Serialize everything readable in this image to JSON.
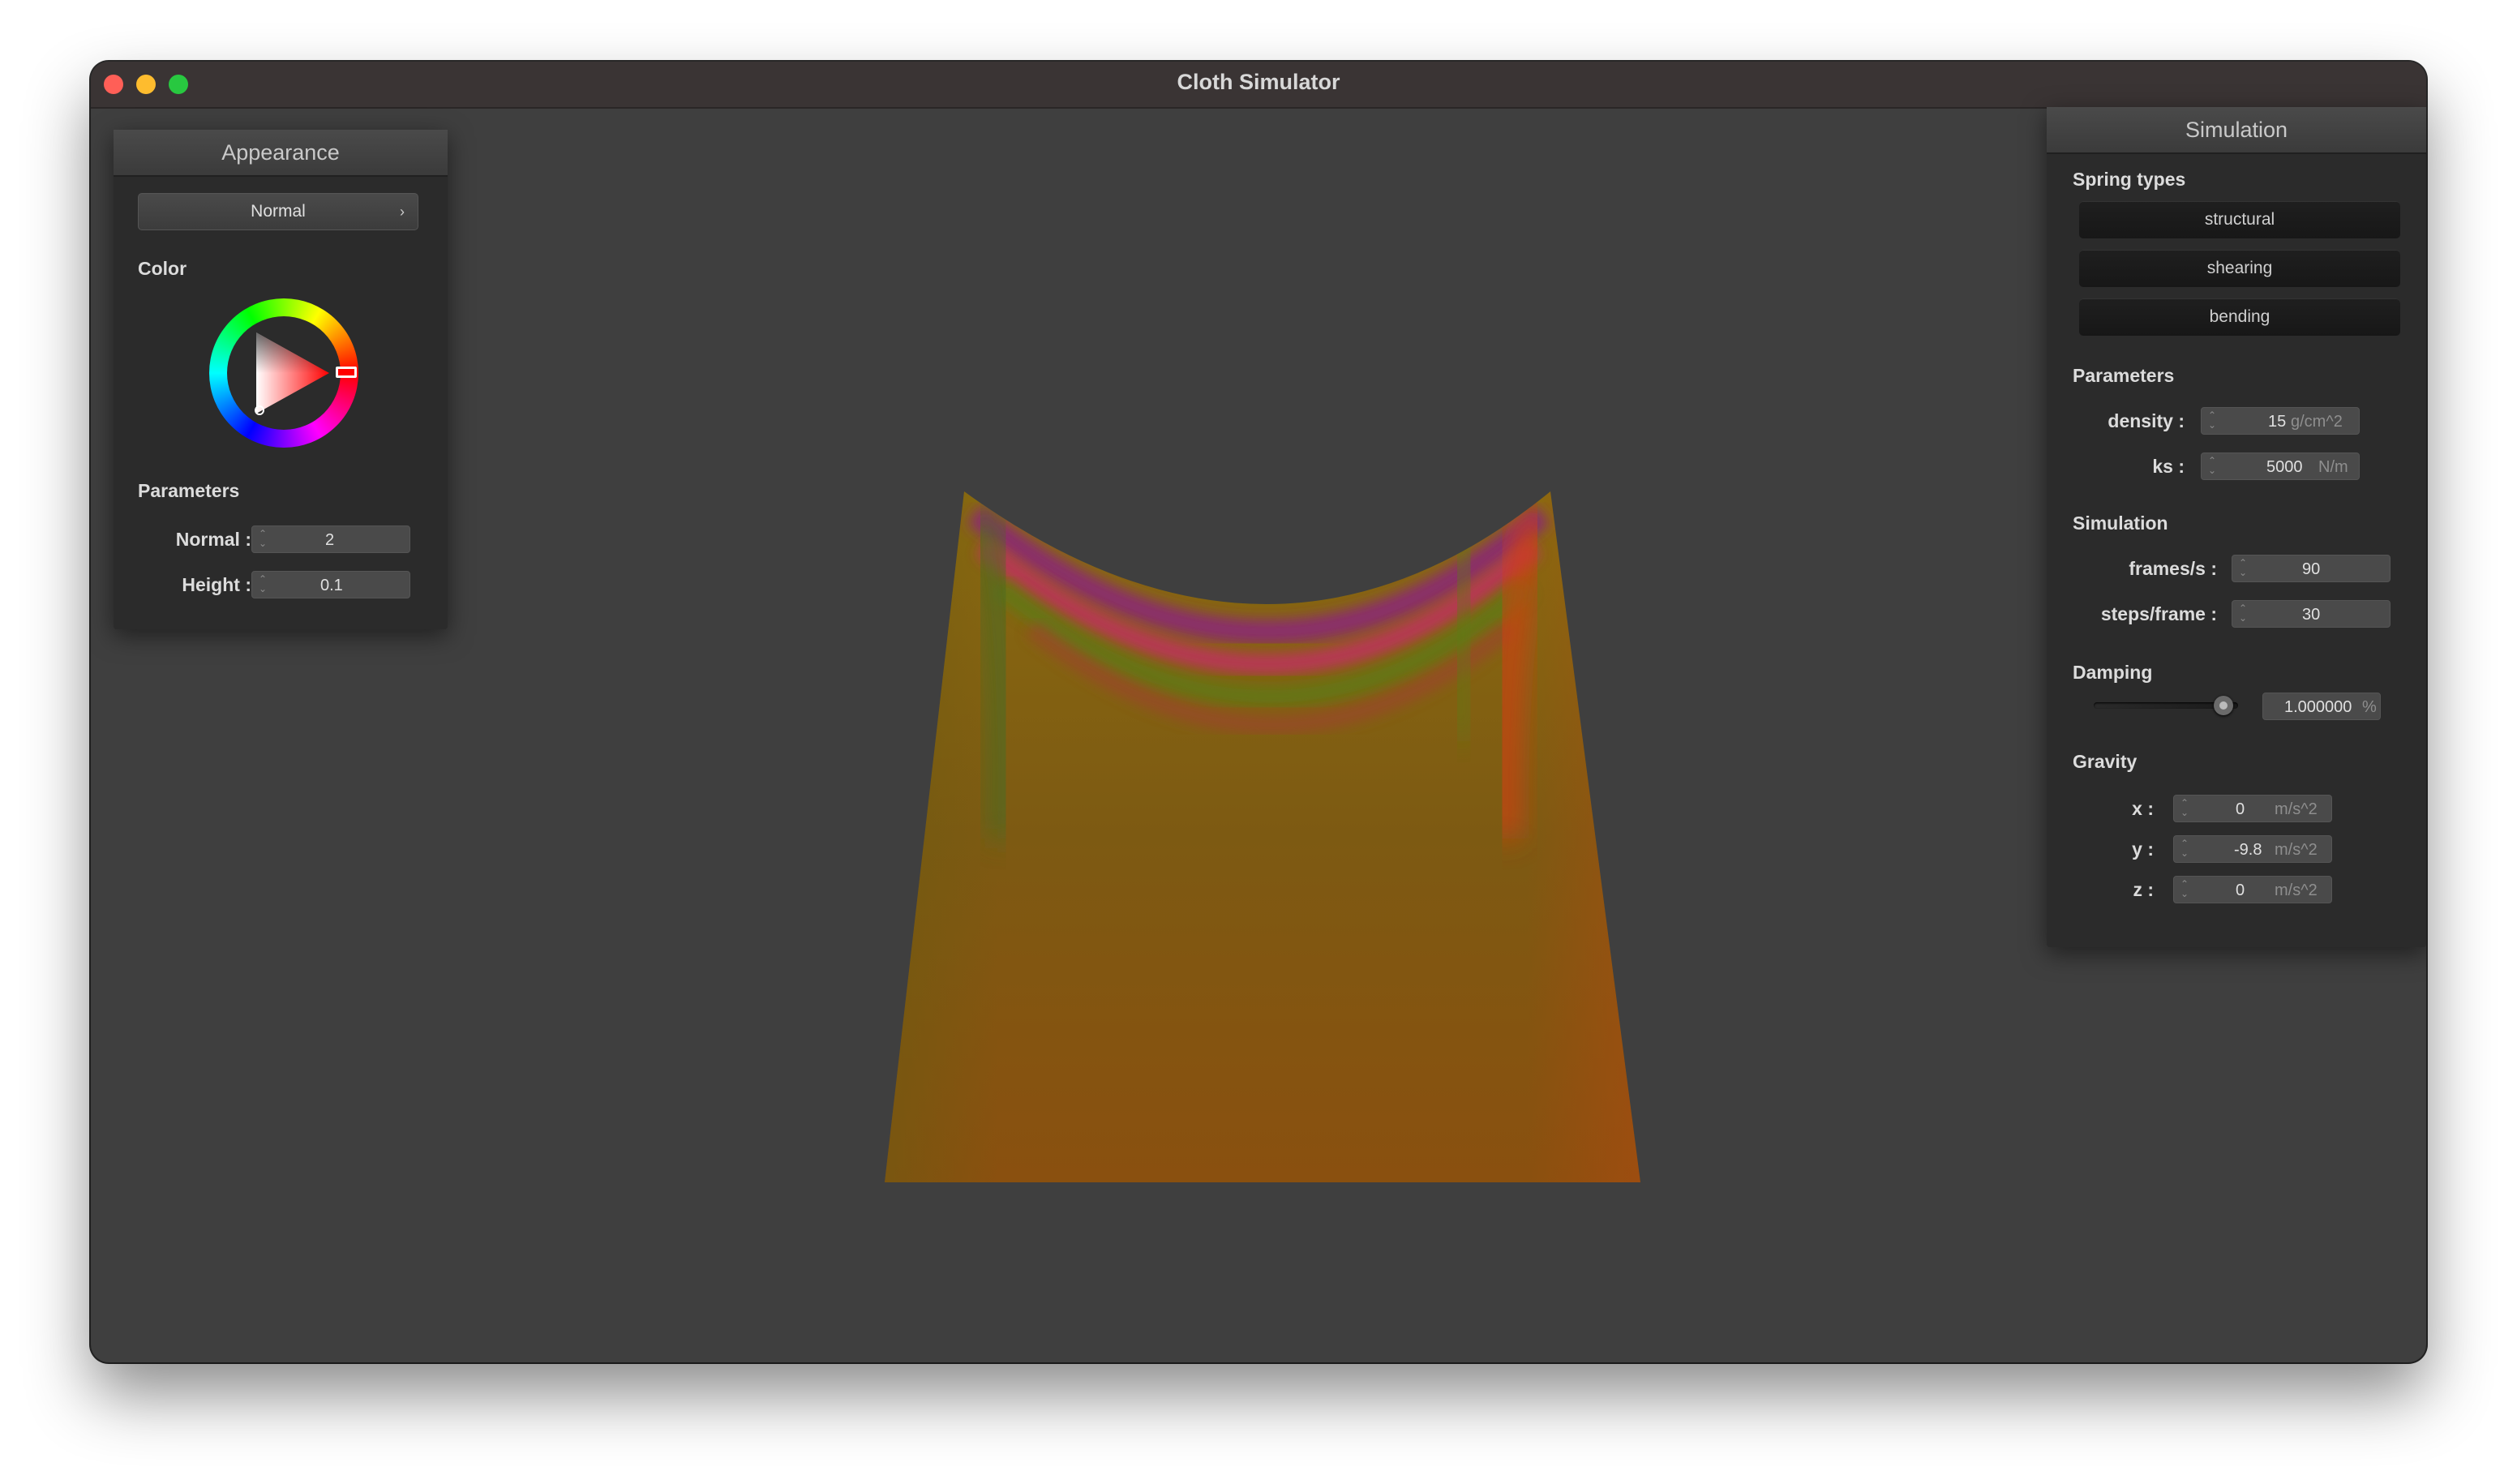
{
  "window": {
    "title": "Cloth Simulator"
  },
  "appearance": {
    "header": "Appearance",
    "shader_select": "Normal",
    "color_label": "Color",
    "parameters_label": "Parameters",
    "normal_label": "Normal :",
    "normal_value": "2",
    "height_label": "Height :",
    "height_value": "0.1"
  },
  "simulation": {
    "header": "Simulation",
    "spring_types_label": "Spring types",
    "spring_buttons": [
      "structural",
      "shearing",
      "bending"
    ],
    "parameters_label": "Parameters",
    "density_label": "density :",
    "density_value": "15",
    "density_unit": "g/cm^2",
    "ks_label": "ks :",
    "ks_value": "5000",
    "ks_unit": "N/m",
    "simulation_label": "Simulation",
    "fps_label": "frames/s :",
    "fps_value": "90",
    "steps_label": "steps/frame :",
    "steps_value": "30",
    "damping_label": "Damping",
    "damping_value": "1.000000",
    "damping_unit": "%",
    "damping_slider_fraction": 0.9,
    "gravity_label": "Gravity",
    "gx_label": "x :",
    "gx_value": "0",
    "gy_label": "y :",
    "gy_value": "-9.8",
    "gz_label": "z :",
    "gz_value": "0",
    "gravity_unit": "m/s^2"
  },
  "colors": {
    "traffic_close": "#ff5f57",
    "traffic_minimize": "#febc2e",
    "traffic_zoom": "#28c840",
    "cloth_base": "#8a5a10",
    "viewport_bg": "#3f3f3f"
  }
}
